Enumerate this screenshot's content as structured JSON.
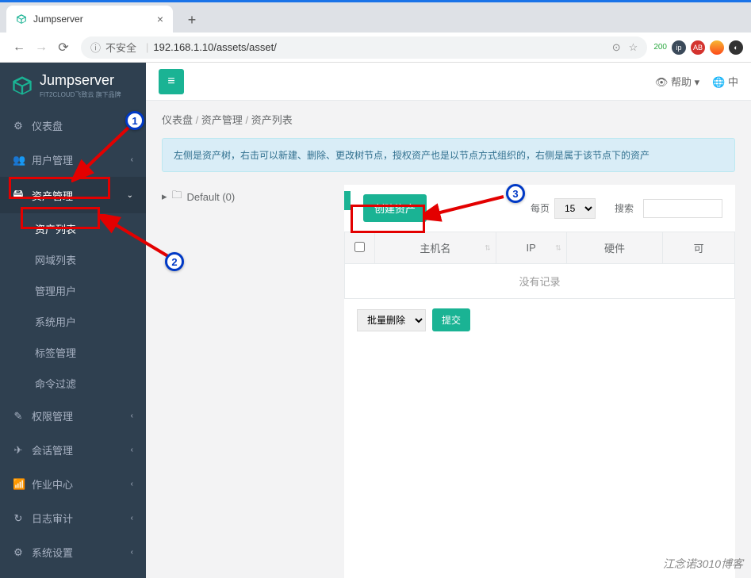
{
  "browser": {
    "tab_title": "Jumpserver",
    "url_insecure_label": "不安全",
    "url": "192.168.1.10/assets/asset/",
    "badge_count": "200"
  },
  "logo": {
    "name": "Jumpserver",
    "tagline": "FIT2CLOUD飞致云 旗下品牌"
  },
  "sidebar": {
    "dashboard": "仪表盘",
    "users": "用户管理",
    "assets": "资产管理",
    "assets_sub": {
      "asset_list": "资产列表",
      "domain_list": "网域列表",
      "admin_user": "管理用户",
      "system_user": "系统用户",
      "label": "标签管理",
      "cmd_filter": "命令过滤"
    },
    "perms": "权限管理",
    "sessions": "会话管理",
    "jobs": "作业中心",
    "audits": "日志审计",
    "settings": "系统设置"
  },
  "topbar": {
    "help": "帮助",
    "lang": "中"
  },
  "breadcrumb": {
    "a": "仪表盘",
    "b": "资产管理",
    "c": "资产列表"
  },
  "info": "左侧是资产树，右击可以新建、删除、更改树节点，授权资产也是以节点方式组织的，右侧是属于该节点下的资产",
  "tree": {
    "default_node": "Default (0)"
  },
  "actions": {
    "create": "创建资产",
    "per_page_label": "每页",
    "per_page_value": "15",
    "search_label": "搜索",
    "bulk_delete": "批量删除",
    "submit": "提交"
  },
  "table": {
    "cols": {
      "hostname": "主机名",
      "ip": "IP",
      "hardware": "硬件",
      "reachable": "可"
    },
    "empty": "没有记录"
  },
  "callouts": {
    "c1": "1",
    "c2": "2",
    "c3": "3"
  },
  "watermark": "江念诺3010博客"
}
